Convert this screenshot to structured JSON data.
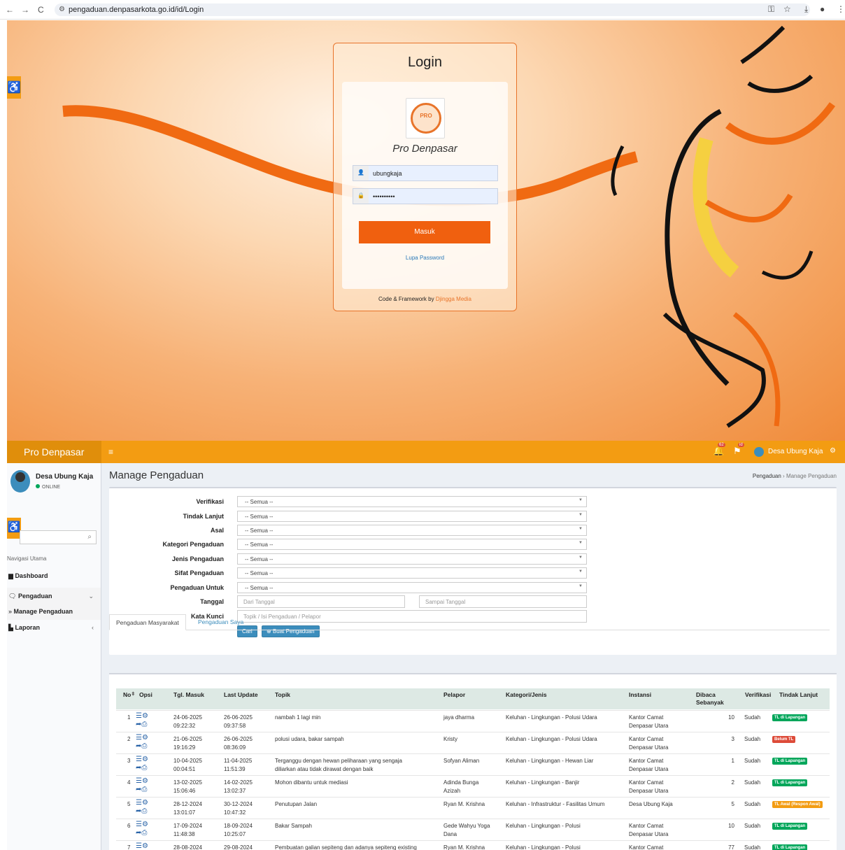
{
  "browser": {
    "url": "pengaduan.denpasarkota.go.id/id/Login",
    "back": "←",
    "forward": "→",
    "reload": "C"
  },
  "login": {
    "title": "Login",
    "app_name": "Pro Denpasar",
    "logo_text": "PRO",
    "username_value": "ubungkaja",
    "password_value": "••••••••••",
    "submit_label": "Masuk",
    "forgot_label": "Lupa Password",
    "credit_prefix": "Code & Framework by ",
    "credit_link": "Djingga Media"
  },
  "app": {
    "brand": "Pro Denpasar",
    "user_name": "Desa Ubung Kaja",
    "notif_count_1": "62",
    "notif_count_2": "id",
    "status": "ONLINE",
    "nav_header": "Navigasi Utama",
    "menu": {
      "dashboard": "Dashboard",
      "pengaduan": "Pengaduan",
      "manage": "Manage Pengaduan",
      "laporan": "Laporan"
    },
    "page_title": "Manage Pengaduan",
    "breadcrumb": {
      "root": "Pengaduan",
      "sep": " › ",
      "current": "Manage Pengaduan"
    }
  },
  "filters": {
    "labels": {
      "verifikasi": "Verifikasi",
      "tindak_lanjut": "Tindak Lanjut",
      "asal": "Asal",
      "kategori": "Kategori Pengaduan",
      "jenis": "Jenis Pengaduan",
      "sifat": "Sifat Pengaduan",
      "untuk": "Pengaduan Untuk",
      "tanggal": "Tanggal",
      "kata_kunci": "Kata Kunci"
    },
    "select_value": "-- Semua --",
    "date_from_placeholder": "Dari Tanggal",
    "date_to_placeholder": "Sampai Tanggal",
    "keyword_placeholder": "Topik / Isi Pengaduan / Pelapor",
    "search_button": "Cari",
    "create_button": "Buat Pengaduan"
  },
  "tabs": [
    "Pengaduan Masyarakat",
    "Pengaduan Saya"
  ],
  "table": {
    "headers": {
      "no": "No",
      "opsi": "Opsi",
      "tgl_masuk": "Tgl. Masuk",
      "last_update": "Last Update",
      "topik": "Topik",
      "pelapor": "Pelapor",
      "kategori": "Kategori/Jenis",
      "instansi": "Instansi",
      "dibaca": "Dibaca Sebanyak",
      "verifikasi": "Verifikasi",
      "tindak_lanjut": "Tindak Lanjut"
    },
    "rows": [
      {
        "no": "1",
        "tgl": "24-06-2025",
        "tgl_t": "09:22:32",
        "upd": "26-06-2025",
        "upd_t": "09:37:58",
        "topik": "nambah 1 lagi min",
        "topik2": "",
        "pelapor": "jaya dharma",
        "pelapor2": "",
        "kategori": "Keluhan - Lingkungan - Polusi Udara",
        "inst": "Kantor Camat",
        "inst2": "Denpasar Utara",
        "dibaca": "10",
        "verif": "Sudah",
        "tl": "TL di Lapangan",
        "tl_color": "#00a65a"
      },
      {
        "no": "2",
        "tgl": "21-06-2025",
        "tgl_t": "19:16:29",
        "upd": "26-06-2025",
        "upd_t": "08:36:09",
        "topik": "polusi udara, bakar sampah",
        "topik2": "",
        "pelapor": "Kristy",
        "pelapor2": "",
        "kategori": "Keluhan - Lingkungan - Polusi Udara",
        "inst": "Kantor Camat",
        "inst2": "Denpasar Utara",
        "dibaca": "3",
        "verif": "Sudah",
        "tl": "Belum TL",
        "tl_color": "#dd4b39"
      },
      {
        "no": "3",
        "tgl": "10-04-2025",
        "tgl_t": "00:04:51",
        "upd": "11-04-2025",
        "upd_t": "11:51:39",
        "topik": "Terganggu dengan hewan peliharaan yang sengaja",
        "topik2": "diliarkan atau tidak dirawat dengan baik",
        "pelapor": "Sofyan Aliman",
        "pelapor2": "",
        "kategori": "Keluhan - Lingkungan - Hewan Liar",
        "inst": "Kantor Camat",
        "inst2": "Denpasar Utara",
        "dibaca": "1",
        "verif": "Sudah",
        "tl": "TL di Lapangan",
        "tl_color": "#00a65a"
      },
      {
        "no": "4",
        "tgl": "13-02-2025",
        "tgl_t": "15:06:46",
        "upd": "14-02-2025",
        "upd_t": "13:02:37",
        "topik": "Mohon dibantu untuk mediasi",
        "topik2": "",
        "pelapor": "Adinda Bunga",
        "pelapor2": "Azizah",
        "kategori": "Keluhan - Lingkungan - Banjir",
        "inst": "Kantor Camat",
        "inst2": "Denpasar Utara",
        "dibaca": "2",
        "verif": "Sudah",
        "tl": "TL di Lapangan",
        "tl_color": "#00a65a"
      },
      {
        "no": "5",
        "tgl": "28-12-2024",
        "tgl_t": "13:01:07",
        "upd": "30-12-2024",
        "upd_t": "10:47:32",
        "topik": "Penutupan Jalan",
        "topik2": "",
        "pelapor": "Ryan M. Krishna",
        "pelapor2": "",
        "kategori": "Keluhan - Infrastruktur - Fasilitas Umum",
        "inst": "Desa Ubung Kaja",
        "inst2": "",
        "dibaca": "5",
        "verif": "Sudah",
        "tl": "TL Awal (Respon Awal)",
        "tl_color": "#f39c12"
      },
      {
        "no": "6",
        "tgl": "17-09-2024",
        "tgl_t": "11:48:38",
        "upd": "18-09-2024",
        "upd_t": "10:25:07",
        "topik": "Bakar Sampah",
        "topik2": "",
        "pelapor": "Gede Wahyu Yoga",
        "pelapor2": "Dana",
        "kategori": "Keluhan - Lingkungan - Polusi",
        "inst": "Kantor Camat",
        "inst2": "Denpasar Utara",
        "dibaca": "10",
        "verif": "Sudah",
        "tl": "TL di Lapangan",
        "tl_color": "#00a65a"
      },
      {
        "no": "7",
        "tgl": "28-08-2024",
        "tgl_t": "",
        "upd": "29-08-2024",
        "upd_t": "",
        "topik": "Pembuatan galian sepiteng dan adanya sepiteng existing",
        "topik2": "",
        "pelapor": "Ryan M. Krishna",
        "pelapor2": "",
        "kategori": "Keluhan - Lingkungan - Polusi",
        "inst": "Kantor Camat",
        "inst2": "",
        "dibaca": "77",
        "verif": "Sudah",
        "tl": "TL di Lapangan",
        "tl_color": "#00a65a"
      }
    ]
  },
  "colors": {
    "accent": "#f39c12",
    "primary": "#3c8dbc",
    "login_button": "#f0600f"
  }
}
